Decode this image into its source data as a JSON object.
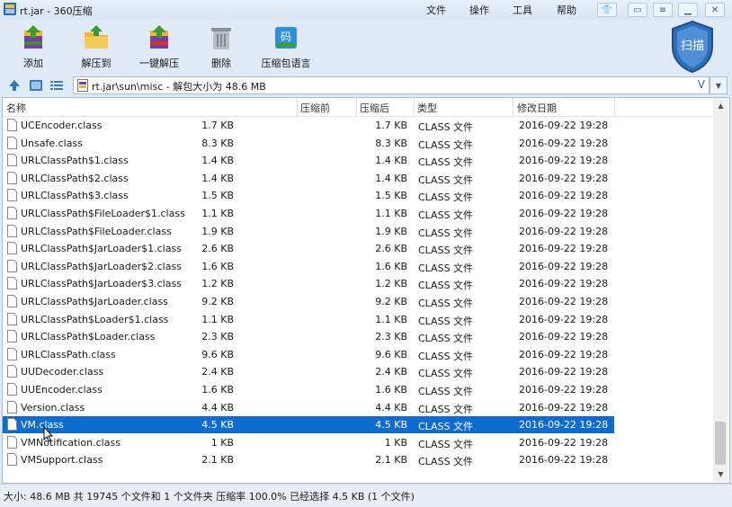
{
  "window": {
    "title": "rt.jar - 360压缩"
  },
  "menu": [
    "文件",
    "操作",
    "工具",
    "帮助"
  ],
  "toolbar": {
    "add": "添加",
    "extract_to": "解压到",
    "one_click": "一键解压",
    "delete": "删除",
    "language": "压缩包语言",
    "scan": "扫描",
    "code_glyph": "码"
  },
  "address": {
    "path": "rt.jar\\sun\\misc - 解包大小为 48.6 MB",
    "v_glyph": "V"
  },
  "columns": {
    "name": "名称",
    "packed_before": "压缩前",
    "packed_after": "压缩后",
    "type": "类型",
    "modified": "修改日期"
  },
  "files": [
    {
      "name": "UCEncoder.class",
      "before": "1.7 KB",
      "after": "1.7 KB",
      "type": "CLASS 文件",
      "date": "2016-09-22 19:28"
    },
    {
      "name": "Unsafe.class",
      "before": "8.3 KB",
      "after": "8.3 KB",
      "type": "CLASS 文件",
      "date": "2016-09-22 19:28"
    },
    {
      "name": "URLClassPath$1.class",
      "before": "1.4 KB",
      "after": "1.4 KB",
      "type": "CLASS 文件",
      "date": "2016-09-22 19:28"
    },
    {
      "name": "URLClassPath$2.class",
      "before": "1.4 KB",
      "after": "1.4 KB",
      "type": "CLASS 文件",
      "date": "2016-09-22 19:28"
    },
    {
      "name": "URLClassPath$3.class",
      "before": "1.5 KB",
      "after": "1.5 KB",
      "type": "CLASS 文件",
      "date": "2016-09-22 19:28"
    },
    {
      "name": "URLClassPath$FileLoader$1.class",
      "before": "1.1 KB",
      "after": "1.1 KB",
      "type": "CLASS 文件",
      "date": "2016-09-22 19:28"
    },
    {
      "name": "URLClassPath$FileLoader.class",
      "before": "1.9 KB",
      "after": "1.9 KB",
      "type": "CLASS 文件",
      "date": "2016-09-22 19:28"
    },
    {
      "name": "URLClassPath$JarLoader$1.class",
      "before": "2.6 KB",
      "after": "2.6 KB",
      "type": "CLASS 文件",
      "date": "2016-09-22 19:28"
    },
    {
      "name": "URLClassPath$JarLoader$2.class",
      "before": "1.6 KB",
      "after": "1.6 KB",
      "type": "CLASS 文件",
      "date": "2016-09-22 19:28"
    },
    {
      "name": "URLClassPath$JarLoader$3.class",
      "before": "1.2 KB",
      "after": "1.2 KB",
      "type": "CLASS 文件",
      "date": "2016-09-22 19:28"
    },
    {
      "name": "URLClassPath$JarLoader.class",
      "before": "9.2 KB",
      "after": "9.2 KB",
      "type": "CLASS 文件",
      "date": "2016-09-22 19:28"
    },
    {
      "name": "URLClassPath$Loader$1.class",
      "before": "1.1 KB",
      "after": "1.1 KB",
      "type": "CLASS 文件",
      "date": "2016-09-22 19:28"
    },
    {
      "name": "URLClassPath$Loader.class",
      "before": "2.3 KB",
      "after": "2.3 KB",
      "type": "CLASS 文件",
      "date": "2016-09-22 19:28"
    },
    {
      "name": "URLClassPath.class",
      "before": "9.6 KB",
      "after": "9.6 KB",
      "type": "CLASS 文件",
      "date": "2016-09-22 19:28"
    },
    {
      "name": "UUDecoder.class",
      "before": "2.4 KB",
      "after": "2.4 KB",
      "type": "CLASS 文件",
      "date": "2016-09-22 19:28"
    },
    {
      "name": "UUEncoder.class",
      "before": "1.6 KB",
      "after": "1.6 KB",
      "type": "CLASS 文件",
      "date": "2016-09-22 19:28"
    },
    {
      "name": "Version.class",
      "before": "4.4 KB",
      "after": "4.4 KB",
      "type": "CLASS 文件",
      "date": "2016-09-22 19:28"
    },
    {
      "name": "VM.class",
      "before": "4.5 KB",
      "after": "4.5 KB",
      "type": "CLASS 文件",
      "date": "2016-09-22 19:28",
      "selected": true
    },
    {
      "name": "VMNotification.class",
      "before": "1 KB",
      "after": "1 KB",
      "type": "CLASS 文件",
      "date": "2016-09-22 19:28"
    },
    {
      "name": "VMSupport.class",
      "before": "2.1 KB",
      "after": "2.1 KB",
      "type": "CLASS 文件",
      "date": "2016-09-22 19:28"
    }
  ],
  "status": {
    "text": "大小: 48.6 MB 共 19745 个文件和 1 个文件夹 压缩率 100.0% 已经选择 4.5 KB (1 个文件)"
  },
  "colors": {
    "selection": "#0e6ccf",
    "chrome": "#dfeaf6",
    "accent": "#2f6fb7"
  }
}
